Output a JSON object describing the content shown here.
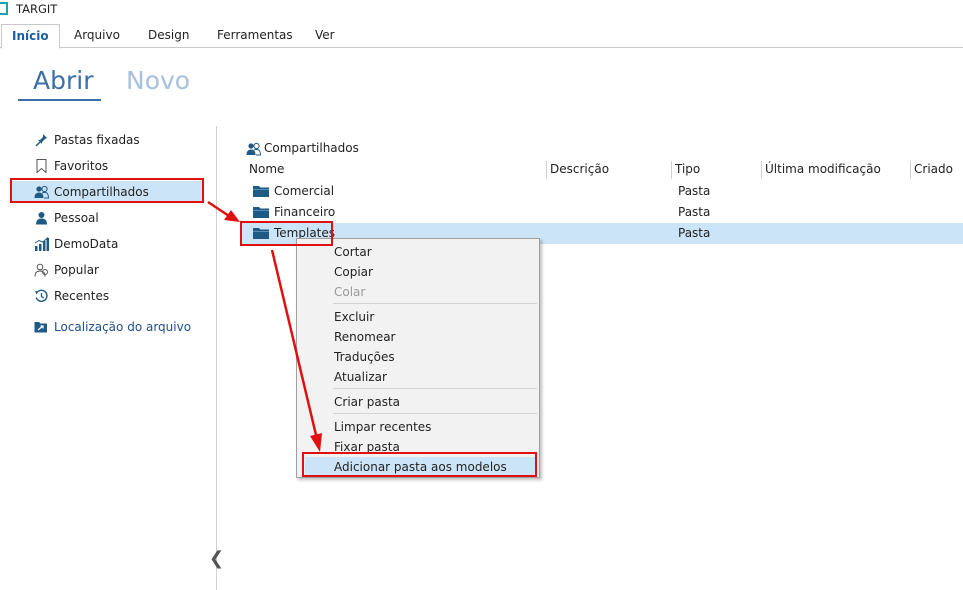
{
  "app": {
    "title": "TARGIT"
  },
  "ribbon": {
    "tabs": [
      "Início",
      "Arquivo",
      "Design",
      "Ferramentas",
      "Ver"
    ]
  },
  "view_tabs": {
    "abrir": "Abrir",
    "novo": "Novo"
  },
  "nav": {
    "items": [
      {
        "label": "Pastas fixadas",
        "icon": "pin-icon"
      },
      {
        "label": "Favoritos",
        "icon": "bookmark-icon"
      },
      {
        "label": "Compartilhados",
        "icon": "shared-users-icon",
        "selected": true
      },
      {
        "label": "Pessoal",
        "icon": "user-icon"
      },
      {
        "label": "DemoData",
        "icon": "bar-chart-icon"
      },
      {
        "label": "Popular",
        "icon": "popular-users-icon"
      },
      {
        "label": "Recentes",
        "icon": "history-icon"
      }
    ],
    "file_location": "Localização do arquivo"
  },
  "main": {
    "breadcrumb": "Compartilhados",
    "columns": [
      "Nome",
      "Descrição",
      "Tipo",
      "Última modificação",
      "Criado"
    ],
    "rows": [
      {
        "name": "Comercial",
        "type": "Pasta"
      },
      {
        "name": "Financeiro",
        "type": "Pasta"
      },
      {
        "name": "Templates",
        "type": "Pasta",
        "selected": true
      }
    ]
  },
  "context_menu": {
    "items": [
      "Cortar",
      "Copiar",
      "Colar",
      "Excluir",
      "Renomear",
      "Traduções",
      "Atualizar",
      "Criar pasta",
      "Limpar recentes",
      "Fixar pasta",
      "Adicionar pasta aos modelos"
    ],
    "disabled": [
      "Colar"
    ],
    "highlighted": "Adicionar pasta aos modelos"
  },
  "colors": {
    "accent": "#3a6fa8",
    "selection": "#cce4f7",
    "annotation": "#e01010",
    "folder": "#1f5a85"
  },
  "collapse_glyph": "❮"
}
